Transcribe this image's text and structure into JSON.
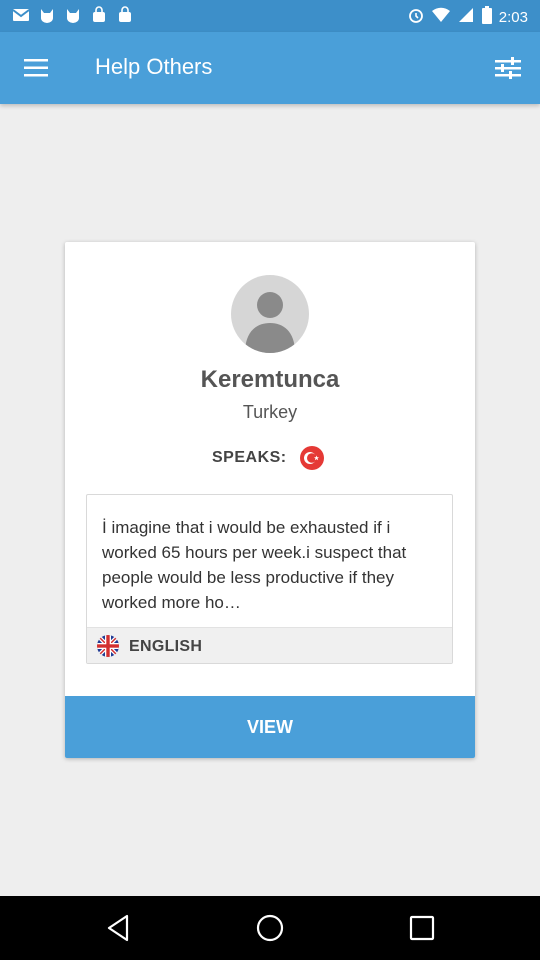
{
  "status_bar": {
    "time": "2:03",
    "icons": [
      "gmail-icon",
      "cat-icon",
      "cat-icon",
      "bag-icon",
      "bag-icon",
      "alarm-icon",
      "wifi-icon",
      "signal-icon",
      "battery-icon"
    ]
  },
  "app_bar": {
    "title": "Help Others",
    "menu_icon": "hamburger-menu-icon",
    "filter_icon": "filter-sliders-icon"
  },
  "card": {
    "name": "Keremtunca",
    "country": "Turkey",
    "speaks_label": "SPEAKS:",
    "speaks_flag": "turkey-flag-icon",
    "post_text": "İ imagine that i would be exhausted if i worked 65 hours per week.i suspect that people would be less productive if they worked more ho…",
    "post_language": "ENGLISH",
    "post_language_flag": "uk-flag-icon",
    "view_label": "VIEW"
  },
  "colors": {
    "status_bar": "#3d8fc9",
    "primary": "#4a9fd9",
    "background": "#eeeeee",
    "turkey_red": "#e53935"
  },
  "nav_bar": {
    "icons": [
      "back-icon",
      "home-icon",
      "recents-icon"
    ]
  }
}
